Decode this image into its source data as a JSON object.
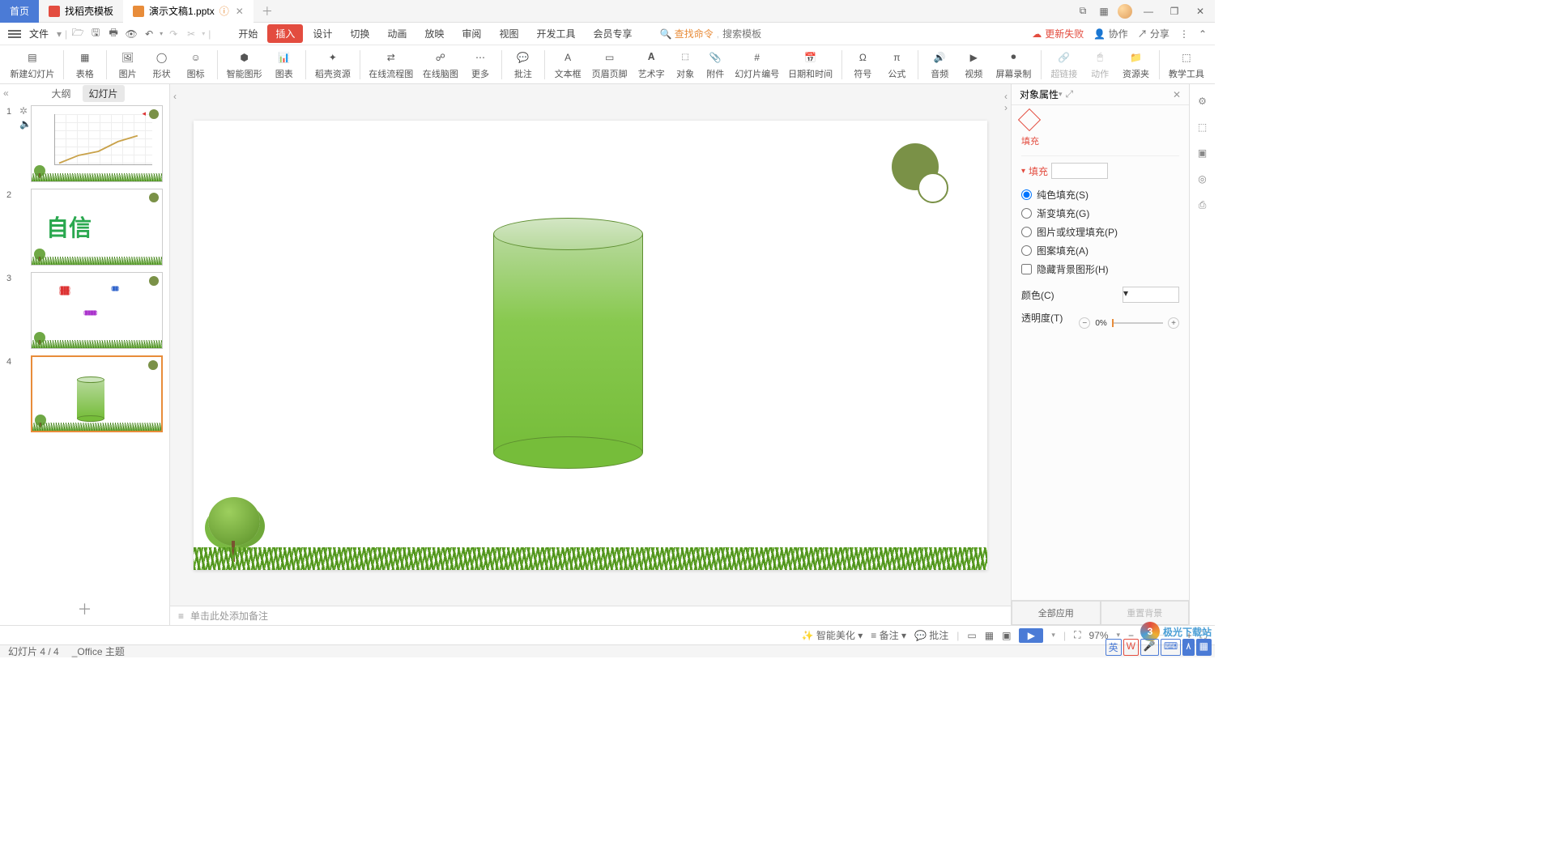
{
  "titlebar": {
    "home": "首页",
    "tab_templates": "找稻壳模板",
    "tab_presentation": "演示文稿1.pptx"
  },
  "quickaccess": {
    "file": "文件"
  },
  "search": {
    "cmd": "查找命令",
    "placeholder": "搜索模板"
  },
  "menurow_right": {
    "update_fail": "更新失败",
    "coop": "协作",
    "share": "分享"
  },
  "menu": {
    "start": "开始",
    "insert": "插入",
    "design": "设计",
    "transition": "切换",
    "animation": "动画",
    "slideshow": "放映",
    "review": "审阅",
    "view": "视图",
    "devtools": "开发工具",
    "member": "会员专享"
  },
  "ribbon": {
    "new_slide": "新建幻灯片",
    "table": "表格",
    "picture": "图片",
    "shape": "形状",
    "icon": "图标",
    "smartart": "智能图形",
    "chart": "图表",
    "doker": "稻壳资源",
    "flowchart": "在线流程图",
    "mindmap": "在线脑图",
    "more": "更多",
    "annotate": "批注",
    "textbox": "文本框",
    "headerfooter": "页眉页脚",
    "wordart": "艺术字",
    "object": "对象",
    "attachment": "附件",
    "slidenumber": "幻灯片编号",
    "datetime": "日期和时间",
    "symbol": "符号",
    "formula": "公式",
    "audio": "音频",
    "video": "视频",
    "screenrec": "屏幕录制",
    "hyperlink": "超链接",
    "action": "动作",
    "resource": "资源夹",
    "teachtools": "教学工具"
  },
  "sidepanel": {
    "outline": "大纲",
    "slides": "幻灯片"
  },
  "thumbs": {
    "t2_text": "自信"
  },
  "notes": {
    "placeholder": "单击此处添加备注"
  },
  "prop": {
    "title": "对象属性",
    "fill_tab": "填充",
    "fill_section": "填充",
    "solid": "纯色填充(S)",
    "gradient": "渐变填充(G)",
    "pic": "图片或纹理填充(P)",
    "pattern": "图案填充(A)",
    "hidebg": "隐藏背景图形(H)",
    "color": "颜色(C)",
    "opacity": "透明度(T)",
    "opacity_val": "0%",
    "apply_all": "全部应用",
    "reset_bg": "重置背景"
  },
  "statusbar": {
    "beautify": "智能美化",
    "notes_btn": "备注",
    "annotate_btn": "批注",
    "zoom": "97%",
    "slide_info": "幻灯片 4 / 4",
    "theme": "_Office 主题"
  }
}
